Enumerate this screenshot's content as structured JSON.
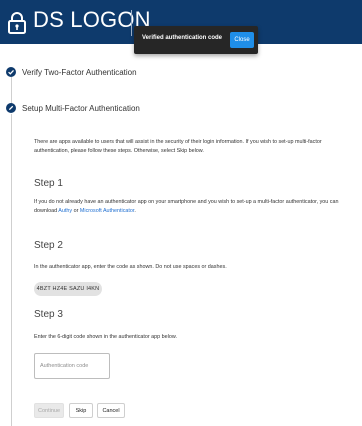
{
  "header": {
    "brand": "DS LOGON",
    "logo_icon": "lock-icon",
    "background": "#0e3a6c"
  },
  "toast": {
    "message": "Verified authentication code",
    "close_label": "Close",
    "background": "#262626",
    "button_color": "#1f8ee8"
  },
  "steps": [
    {
      "title": "Verify Two-Factor Authentication",
      "icon": "check-icon",
      "status": "complete"
    },
    {
      "title": "Setup Multi-Factor Authentication",
      "icon": "pencil-icon",
      "status": "active"
    }
  ],
  "intro": "There are apps available to users that will assist in the security of their login information. If you wish to set-up multi-factor authentication, please follow these steps. Otherwise, select Skip below.",
  "step1": {
    "heading": "Step 1",
    "text_before": "If you do not already have an authenticator app on your smartphone and you wish to set-up a multi-factor authenticator, you can download ",
    "link_authy": "Authy",
    "text_or": " or ",
    "link_microsoft": "Microsoft Authenticator",
    "text_end": "."
  },
  "step2": {
    "heading": "Step 2",
    "text": "In the authenticator app, enter the code as shown. Do not use spaces or dashes.",
    "code": "4BZT HZ4E SAZU I4KN"
  },
  "step3": {
    "heading": "Step 3",
    "text": "Enter the 6-digit code shown in the authenticator app below.",
    "input_placeholder": "Authentication code",
    "input_value": ""
  },
  "actions": {
    "continue_label": "Continue",
    "skip_label": "Skip",
    "cancel_label": "Cancel"
  }
}
